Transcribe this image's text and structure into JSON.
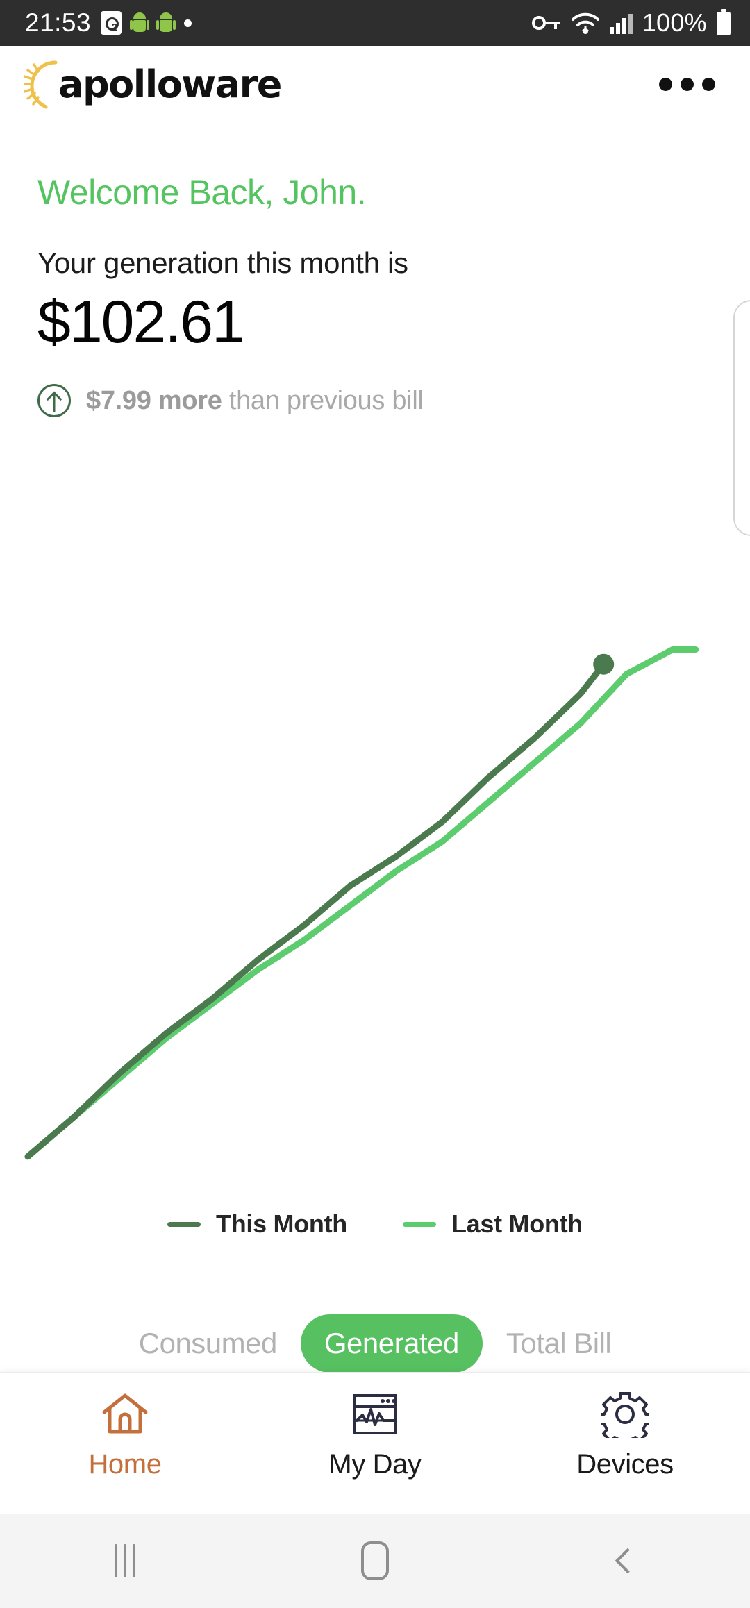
{
  "status_bar": {
    "time": "21:53",
    "battery_text": "100%",
    "left_icons": [
      "sim-card-2-icon",
      "android-robot-icon",
      "android-robot-icon",
      "dot-icon"
    ],
    "right_icons": [
      "vpn-key-icon",
      "wifi-icon",
      "cellular-signal-icon",
      "battery-full-icon"
    ],
    "background": "#2e2e2e"
  },
  "app_bar": {
    "brand": "apolloware",
    "brand_icon": "sun-burst-icon",
    "overflow_label": "more-options"
  },
  "hero": {
    "welcome": "Welcome Back, John.",
    "subtitle": "Your generation this month is",
    "amount": "$102.61",
    "delta_icon": "arrow-up-circle-icon",
    "delta_value": "$7.99 more",
    "delta_suffix": " than previous bill",
    "accent_green": "#53c45f",
    "muted_gray": "#a9a9a9"
  },
  "chart_data": {
    "type": "line",
    "title": "",
    "xlabel": "",
    "ylabel": "",
    "grid": false,
    "legend_position": "bottom",
    "xlim": [
      0,
      30
    ],
    "ylim": [
      0,
      110
    ],
    "series": [
      {
        "name": "This Month",
        "color": "#4c7a4f",
        "end_marker": true,
        "x": [
          0,
          2,
          4,
          6,
          8,
          10,
          12,
          14,
          16,
          18,
          20,
          22,
          24,
          25
        ],
        "y": [
          2,
          10,
          19,
          27,
          34,
          42,
          49,
          57,
          63,
          70,
          79,
          87,
          96,
          102
        ]
      },
      {
        "name": "Last Month",
        "color": "#5ccc6f",
        "end_marker": false,
        "x": [
          0,
          2,
          4,
          6,
          8,
          10,
          12,
          14,
          16,
          18,
          20,
          22,
          24,
          26,
          28,
          29
        ],
        "y": [
          2,
          10,
          18,
          26,
          33,
          40,
          46,
          53,
          60,
          66,
          74,
          82,
          90,
          100,
          105,
          105
        ]
      }
    ]
  },
  "legend": [
    {
      "label": "This Month",
      "color": "#4c7a4f"
    },
    {
      "label": "Last Month",
      "color": "#5ccc6f"
    }
  ],
  "segmented": {
    "options": [
      "Consumed",
      "Generated",
      "Total Bill"
    ],
    "selected": "Generated",
    "selected_bg": "#57c162"
  },
  "bottom_nav": {
    "active": "Home",
    "items": [
      {
        "label": "Home",
        "icon": "home-icon",
        "color": "#c4703c"
      },
      {
        "label": "My Day",
        "icon": "chart-window-icon",
        "color": "#2b2d42"
      },
      {
        "label": "Devices",
        "icon": "gear-icon",
        "color": "#2b2d42"
      }
    ]
  },
  "android_nav": {
    "recents": "recents-icon",
    "home": "home-pill-icon",
    "back": "back-chevron-icon"
  }
}
